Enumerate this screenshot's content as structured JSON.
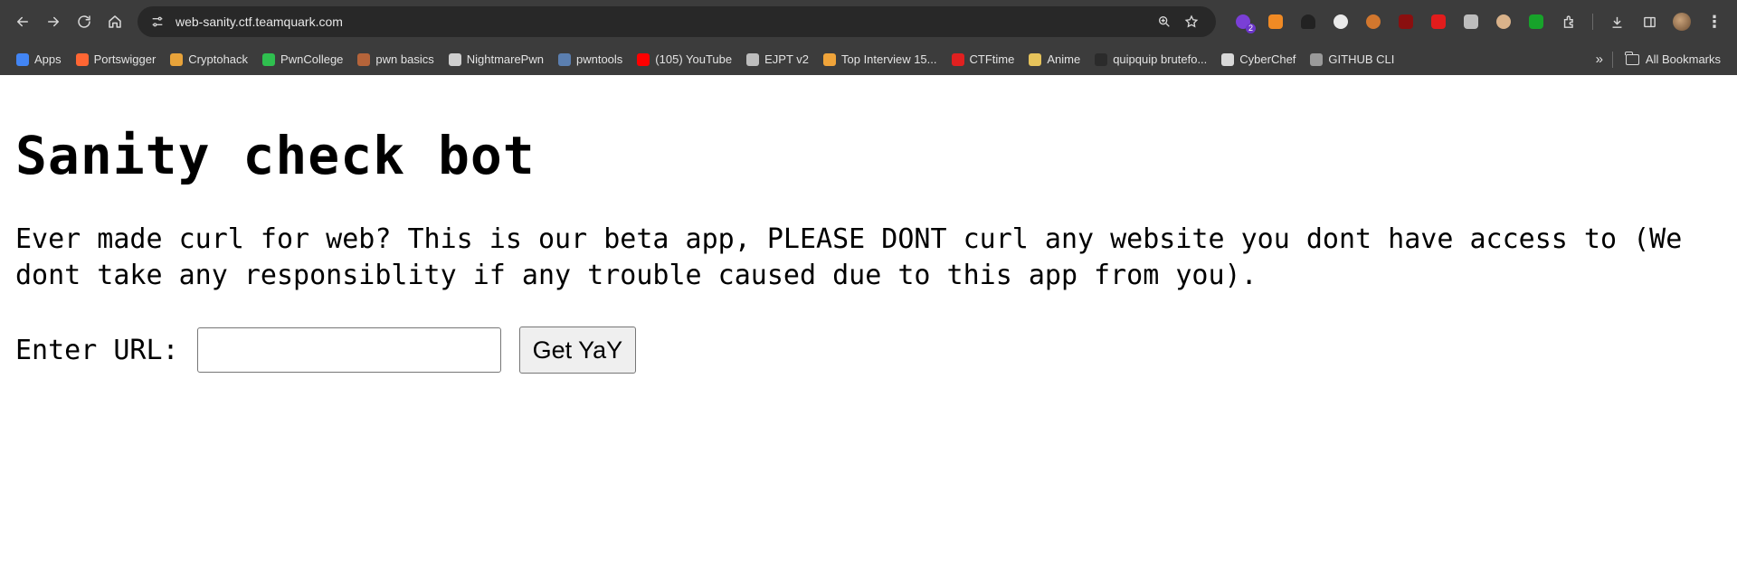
{
  "browser": {
    "url": "web-sanity.ctf.teamquark.com",
    "extension_badge": "2",
    "bookmarks": [
      {
        "label": "Apps",
        "color": "#4285f4"
      },
      {
        "label": "Portswigger",
        "color": "#ff6633"
      },
      {
        "label": "Cryptohack",
        "color": "#e8a33a"
      },
      {
        "label": "PwnCollege",
        "color": "#2fbf4f"
      },
      {
        "label": "pwn basics",
        "color": "#b5643a"
      },
      {
        "label": "NightmarePwn",
        "color": "#cfcfcf"
      },
      {
        "label": "pwntools",
        "color": "#5b7fb0"
      },
      {
        "label": "(105) YouTube",
        "color": "#ff0000"
      },
      {
        "label": "EJPT v2",
        "color": "#bdbdbd"
      },
      {
        "label": "Top Interview 15...",
        "color": "#f0a43a"
      },
      {
        "label": "CTFtime",
        "color": "#e02020"
      },
      {
        "label": "Anime",
        "color": "#e6c35b"
      },
      {
        "label": "quipquip brutefo...",
        "color": "#2b2b2b"
      },
      {
        "label": "CyberChef",
        "color": "#d9d9d9"
      },
      {
        "label": "GITHUB CLI",
        "color": "#9a9a9a"
      }
    ],
    "all_bookmarks_label": "All Bookmarks"
  },
  "page": {
    "title": "Sanity check bot",
    "description": "Ever made curl for web? This is our beta app, PLEASE DONT curl any website you dont have access to (We dont take any responsiblity if any trouble caused due to this app from you).",
    "form": {
      "label": "Enter URL:",
      "input_value": "",
      "submit_label": "Get YaY"
    }
  },
  "colors": {
    "chrome_bg": "#3c3c3c",
    "omnibox_bg": "#282828",
    "page_bg": "#ffffff"
  }
}
